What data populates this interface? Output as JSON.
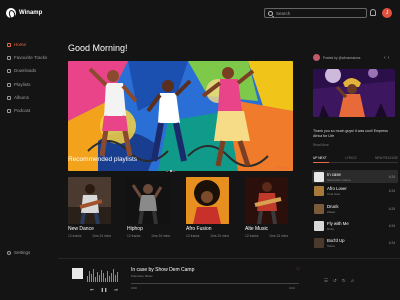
{
  "app": {
    "name": "Winamp"
  },
  "search": {
    "placeholder": "Search"
  },
  "user": {
    "initial": "J"
  },
  "sidebar": {
    "items": [
      {
        "label": "Home",
        "icon": "home-icon"
      },
      {
        "label": "Favourite Tracks",
        "icon": "heart-icon"
      },
      {
        "label": "Downloads",
        "icon": "download-icon"
      },
      {
        "label": "Playlists",
        "icon": "playlist-icon"
      },
      {
        "label": "Albums",
        "icon": "album-icon"
      },
      {
        "label": "Podcast",
        "icon": "podcast-icon"
      }
    ],
    "settings": "Settings"
  },
  "main": {
    "greeting": "Good Morning!",
    "recommended_title": "Recommended playlists",
    "see_all": "SEE ALL",
    "playlists": [
      {
        "title": "New Dance",
        "tracks": "12 tracks",
        "duration": "1hrs 24 mins"
      },
      {
        "title": "Hiphop",
        "tracks": "12 tracks",
        "duration": "1hrs 24 mins"
      },
      {
        "title": "Afro Fusion",
        "tracks": "12 tracks",
        "duration": "1hrs 24 mins"
      },
      {
        "title": "Alte Music",
        "tracks": "12 tracks",
        "duration": "1hrs 24 mins"
      }
    ]
  },
  "right": {
    "feature_user": "Posted by @afrosessions",
    "feature_caption": "Thank you so much guys! it was cool! Empress Africa for Life",
    "feature_link": "Read More",
    "tabs": [
      "UP NEXT",
      "LYRICS",
      "NEW RELEASE"
    ],
    "tracks": [
      {
        "title": "In case",
        "artist": "Show Dem Camp",
        "duration": "4:24"
      },
      {
        "title": "Afro Lover",
        "artist": "Cina Soul",
        "duration": "4:24"
      },
      {
        "title": "Drunk",
        "artist": "Zlatan",
        "duration": "4:24"
      },
      {
        "title": "Fly with Me",
        "artist": "Ruby",
        "duration": "4:24"
      },
      {
        "title": "Bod'd Up",
        "artist": "Tekno",
        "duration": "4:24"
      }
    ]
  },
  "player": {
    "title": "In case by Show Dem Camp",
    "subtitle": "Palmwine Music",
    "elapsed": "0:00",
    "total": "4:24",
    "progress": 0.0
  },
  "colors": {
    "accent": "#e66a45",
    "background": "#141414"
  }
}
